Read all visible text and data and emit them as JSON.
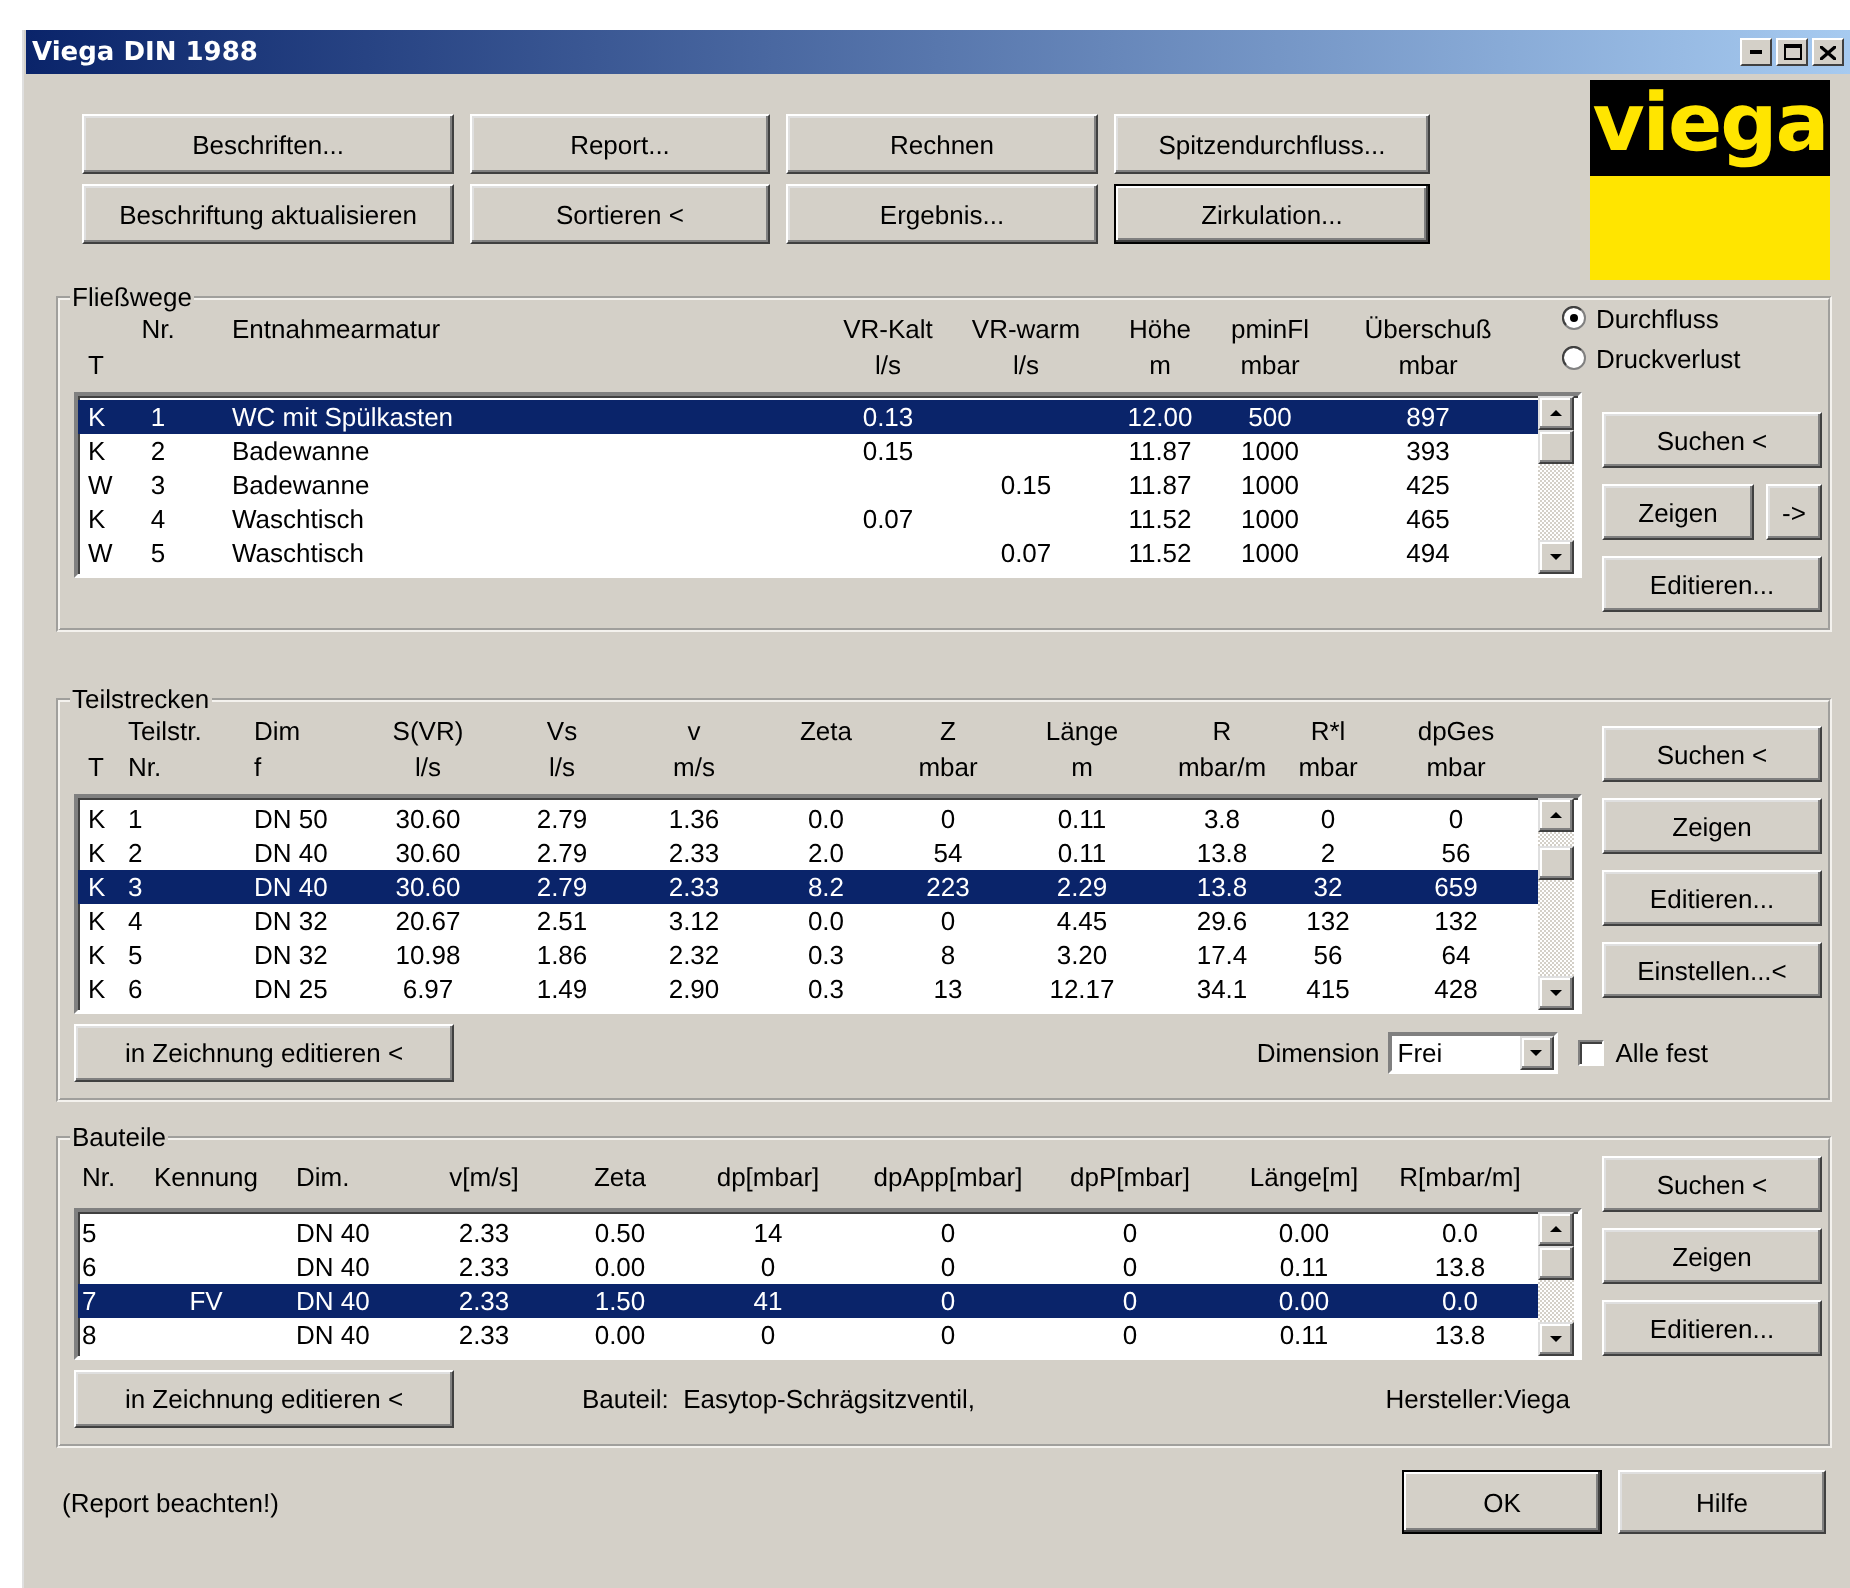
{
  "window": {
    "title": "Viega DIN 1988"
  },
  "toolbar": {
    "buttons": [
      {
        "label": "Beschriften...",
        "focused": false
      },
      {
        "label": "Report...",
        "focused": false
      },
      {
        "label": "Rechnen",
        "focused": false
      },
      {
        "label": "Spitzendurchfluss...",
        "focused": false
      },
      {
        "label": "Beschriftung aktualisieren",
        "focused": false
      },
      {
        "label": "Sortieren <",
        "focused": false
      },
      {
        "label": "Ergebnis...",
        "focused": false
      },
      {
        "label": "Zirkulation...",
        "focused": true
      }
    ]
  },
  "logo": {
    "text": "viega"
  },
  "flow_paths": {
    "title": "Fließwege",
    "columns": [
      {
        "line2": "T"
      },
      {
        "line1": "Nr."
      },
      {
        "line1": "Entnahmearmatur"
      },
      {
        "line1": "VR-Kalt",
        "line2": "l/s"
      },
      {
        "line1": "VR-warm",
        "line2": "l/s"
      },
      {
        "line1": "Höhe",
        "line2": "m"
      },
      {
        "line1": "pminFl",
        "line2": "mbar"
      },
      {
        "line1": "Überschuß",
        "line2": "mbar"
      }
    ],
    "rows": [
      {
        "cells": [
          "K",
          "1",
          "WC mit Spülkasten",
          "0.13",
          null,
          "12.00",
          "500",
          "897"
        ],
        "selected": true
      },
      {
        "cells": [
          "K",
          "2",
          "Badewanne",
          "0.15",
          null,
          "11.87",
          "1000",
          "393"
        ],
        "selected": false
      },
      {
        "cells": [
          "W",
          "3",
          "Badewanne",
          null,
          "0.15",
          "11.87",
          "1000",
          "425"
        ],
        "selected": false
      },
      {
        "cells": [
          "K",
          "4",
          "Waschtisch",
          "0.07",
          null,
          "11.52",
          "1000",
          "465"
        ],
        "selected": false
      },
      {
        "cells": [
          "W",
          "5",
          "Waschtisch",
          null,
          "0.07",
          "11.52",
          "1000",
          "494"
        ],
        "selected": false
      }
    ],
    "modes": [
      {
        "label": "Durchfluss",
        "selected": true
      },
      {
        "label": "Druckverlust",
        "selected": false
      }
    ],
    "buttons": [
      [
        "Suchen <"
      ],
      [
        "Zeigen",
        "->"
      ],
      [
        "Editieren..."
      ]
    ]
  },
  "segments": {
    "title": "Teilstrecken",
    "columns": [
      {
        "line2": "T"
      },
      {
        "line1": "Teilstr.",
        "line2": "Nr."
      },
      {
        "line1": "Dim",
        "line2": "f"
      },
      {
        "line1": "S(VR)",
        "line2": "l/s"
      },
      {
        "line1": "Vs",
        "line2": "l/s"
      },
      {
        "line1": "v",
        "line2": "m/s"
      },
      {
        "line1": "Zeta"
      },
      {
        "line1": "Z",
        "line2": "mbar"
      },
      {
        "line1": "Länge",
        "line2": "m"
      },
      {
        "line1": "R",
        "line2": "mbar/m"
      },
      {
        "line1": "R*l",
        "line2": "mbar"
      },
      {
        "line1": "dpGes",
        "line2": "mbar"
      }
    ],
    "rows": [
      {
        "cells": [
          "K",
          "1",
          "DN 50",
          "30.60",
          "2.79",
          "1.36",
          "0.0",
          "0",
          "0.11",
          "3.8",
          "0",
          "0"
        ],
        "selected": false
      },
      {
        "cells": [
          "K",
          "2",
          "DN 40",
          "30.60",
          "2.79",
          "2.33",
          "2.0",
          "54",
          "0.11",
          "13.8",
          "2",
          "56"
        ],
        "selected": false
      },
      {
        "cells": [
          "K",
          "3",
          "DN 40",
          "30.60",
          "2.79",
          "2.33",
          "8.2",
          "223",
          "2.29",
          "13.8",
          "32",
          "659"
        ],
        "selected": true
      },
      {
        "cells": [
          "K",
          "4",
          "DN 32",
          "20.67",
          "2.51",
          "3.12",
          "0.0",
          "0",
          "4.45",
          "29.6",
          "132",
          "132"
        ],
        "selected": false
      },
      {
        "cells": [
          "K",
          "5",
          "DN 32",
          "10.98",
          "1.86",
          "2.32",
          "0.3",
          "8",
          "3.20",
          "17.4",
          "56",
          "64"
        ],
        "selected": false
      },
      {
        "cells": [
          "K",
          "6",
          "DN 25",
          "6.97",
          "1.49",
          "2.90",
          "0.3",
          "13",
          "12.17",
          "34.1",
          "415",
          "428"
        ],
        "selected": false
      }
    ],
    "buttons": [
      [
        "Suchen <"
      ],
      [
        "Zeigen"
      ],
      [
        "Editieren..."
      ],
      [
        "Einstellen...<"
      ]
    ],
    "edit_button": "in Zeichnung editieren <",
    "dimension": {
      "label": "Dimension",
      "value": "Frei"
    },
    "all_fixed": {
      "label": "Alle fest",
      "checked": false
    }
  },
  "components": {
    "title": "Bauteile",
    "columns": [
      {
        "line1": "Nr."
      },
      {
        "line1": "Kennung"
      },
      {
        "line1": "Dim."
      },
      {
        "line1": "v[m/s]"
      },
      {
        "line1": "Zeta"
      },
      {
        "line1": "dp[mbar]"
      },
      {
        "line1": "dpApp[mbar]"
      },
      {
        "line1": "dpP[mbar]"
      },
      {
        "line1": "Länge[m]"
      },
      {
        "line1": "R[mbar/m]"
      }
    ],
    "rows": [
      {
        "cells": [
          "5",
          null,
          "DN 40",
          "2.33",
          "0.50",
          "14",
          "0",
          "0",
          "0.00",
          "0.0"
        ],
        "selected": false
      },
      {
        "cells": [
          "6",
          null,
          "DN 40",
          "2.33",
          "0.00",
          "0",
          "0",
          "0",
          "0.11",
          "13.8"
        ],
        "selected": false
      },
      {
        "cells": [
          "7",
          "FV",
          "DN 40",
          "2.33",
          "1.50",
          "41",
          "0",
          "0",
          "0.00",
          "0.0"
        ],
        "selected": true
      },
      {
        "cells": [
          "8",
          null,
          "DN 40",
          "2.33",
          "0.00",
          "0",
          "0",
          "0",
          "0.11",
          "13.8"
        ],
        "selected": false
      }
    ],
    "buttons": [
      [
        "Suchen <"
      ],
      [
        "Zeigen"
      ],
      [
        "Editieren..."
      ]
    ],
    "edit_button": "in Zeichnung editieren <",
    "component_info": "Bauteil:  Easytop-Schrägsitzventil,",
    "manufacturer": "Hersteller:Viega"
  },
  "footer": {
    "note": "(Report beachten!)",
    "buttons": [
      {
        "label": "OK",
        "focused": true
      },
      {
        "label": "Hilfe",
        "focused": false
      }
    ]
  }
}
